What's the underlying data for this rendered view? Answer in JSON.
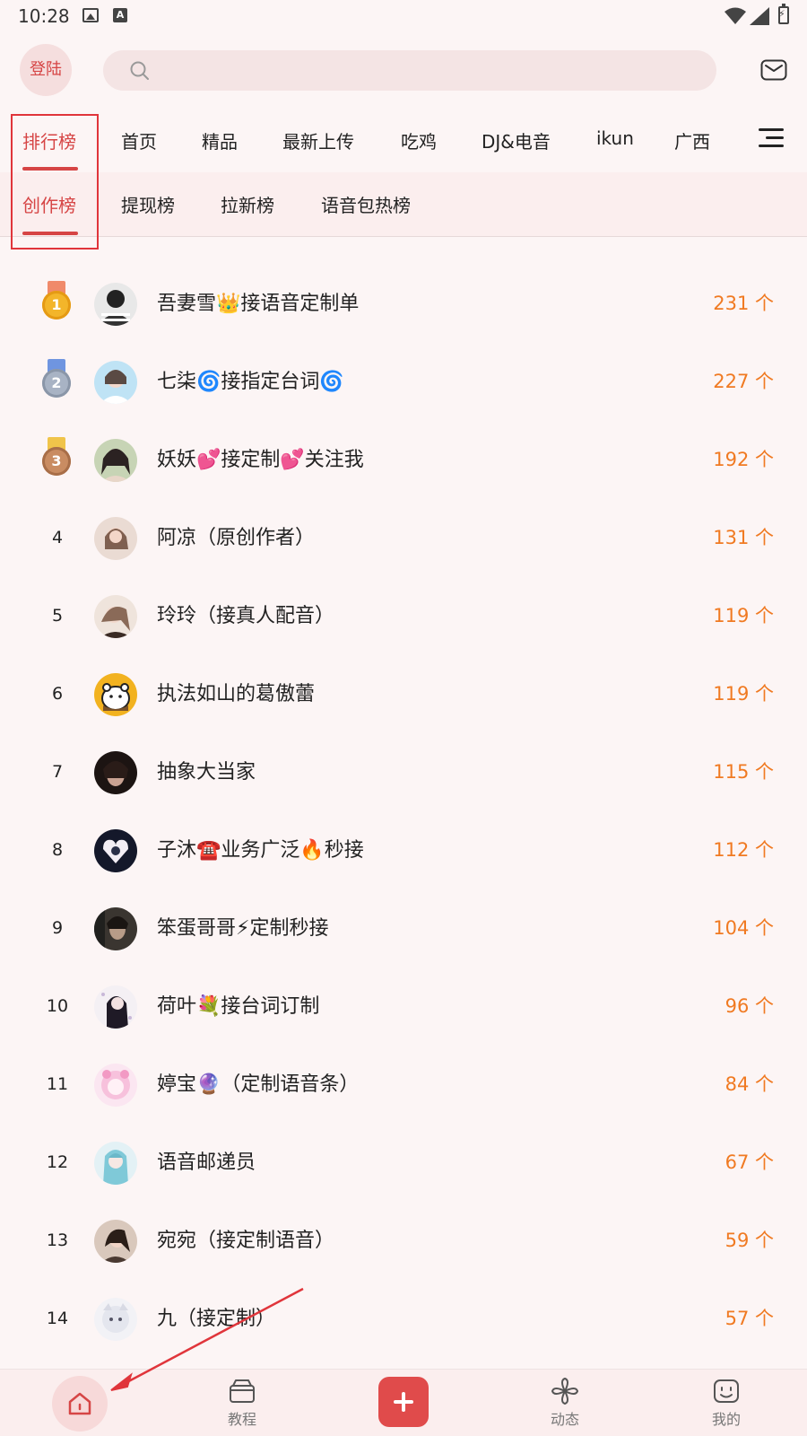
{
  "status_bar": {
    "time": "10:28",
    "icons": [
      "image-icon",
      "a-icon",
      "wifi-icon",
      "cellular-icon",
      "battery-charging-icon"
    ]
  },
  "header": {
    "login_label": "登陆",
    "search_placeholder": "",
    "icons": [
      "search-icon",
      "mail-icon"
    ]
  },
  "tabs": [
    {
      "label": "排行榜",
      "active": true
    },
    {
      "label": "首页",
      "active": false
    },
    {
      "label": "精品",
      "active": false
    },
    {
      "label": "最新上传",
      "active": false
    },
    {
      "label": "吃鸡",
      "active": false
    },
    {
      "label": "DJ&电音",
      "active": false
    },
    {
      "label": "ikun",
      "active": false
    },
    {
      "label": "广西",
      "active": false
    }
  ],
  "subtabs": [
    {
      "label": "创作榜",
      "active": true
    },
    {
      "label": "提现榜",
      "active": false
    },
    {
      "label": "拉新榜",
      "active": false
    },
    {
      "label": "语音包热榜",
      "active": false
    }
  ],
  "ranking": [
    {
      "rank": "1",
      "name": "吾妻雪👑接语音定制单",
      "count": "231 个"
    },
    {
      "rank": "2",
      "name": "七柒🌀接指定台词🌀",
      "count": "227 个"
    },
    {
      "rank": "3",
      "name": "妖妖💕接定制💕关注我",
      "count": "192 个"
    },
    {
      "rank": "4",
      "name": "阿凉（原创作者）",
      "count": "131 个"
    },
    {
      "rank": "5",
      "name": "玲玲（接真人配音）",
      "count": "119 个"
    },
    {
      "rank": "6",
      "name": "执法如山的葛傲蕾",
      "count": "119 个"
    },
    {
      "rank": "7",
      "name": "抽象大当家",
      "count": "115 个"
    },
    {
      "rank": "8",
      "name": "子沐☎️业务广泛🔥秒接",
      "count": "112 个"
    },
    {
      "rank": "9",
      "name": "笨蛋哥哥⚡定制秒接",
      "count": "104 个"
    },
    {
      "rank": "10",
      "name": "荷叶💐接台词订制",
      "count": "96 个"
    },
    {
      "rank": "11",
      "name": "婷宝🔮（定制语音条）",
      "count": "84 个"
    },
    {
      "rank": "12",
      "name": "语音邮递员",
      "count": "67 个"
    },
    {
      "rank": "13",
      "name": "宛宛（接定制语音）",
      "count": "59 个"
    },
    {
      "rank": "14",
      "name": "九（接定制）",
      "count": "57 个"
    }
  ],
  "bottom_nav": {
    "home_label": "",
    "tutorial_label": "教程",
    "add_label": "",
    "feed_label": "动态",
    "mine_label": "我的"
  },
  "colors": {
    "accent": "#d64545",
    "count": "#f07a22",
    "background": "#fcf5f5",
    "annotation": "#e0353b"
  }
}
